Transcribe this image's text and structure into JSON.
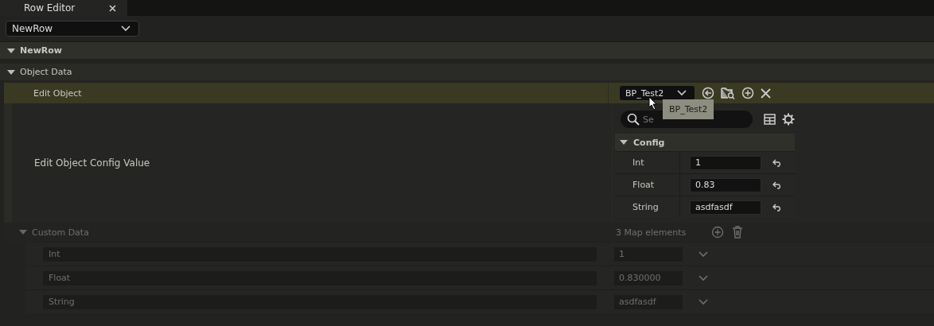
{
  "tab": {
    "label": "Row Editor"
  },
  "row_selector": {
    "value": "NewRow"
  },
  "row_header": {
    "label": "NewRow",
    "expanded": true
  },
  "object_data": {
    "label": "Object Data",
    "expanded": true,
    "edit_object": {
      "label": "Edit Object",
      "value": "BP_Test2",
      "tooltip": "BP_Test2"
    },
    "config_value": {
      "label": "Edit Object Config Value",
      "search": {
        "placeholder": "Se"
      },
      "category": {
        "label": "Config",
        "expanded": true
      },
      "properties": [
        {
          "name": "Int",
          "value": "1"
        },
        {
          "name": "Float",
          "value": "0.83"
        },
        {
          "name": "String",
          "value": "asdfasdf"
        }
      ]
    }
  },
  "custom_data": {
    "label": "Custom Data",
    "expanded": true,
    "disabled": true,
    "count": "3 Map elements",
    "entries": [
      {
        "key": "Int",
        "value": "1"
      },
      {
        "key": "Float",
        "value": "0.830000"
      },
      {
        "key": "String",
        "value": "asdfasdf"
      }
    ]
  }
}
